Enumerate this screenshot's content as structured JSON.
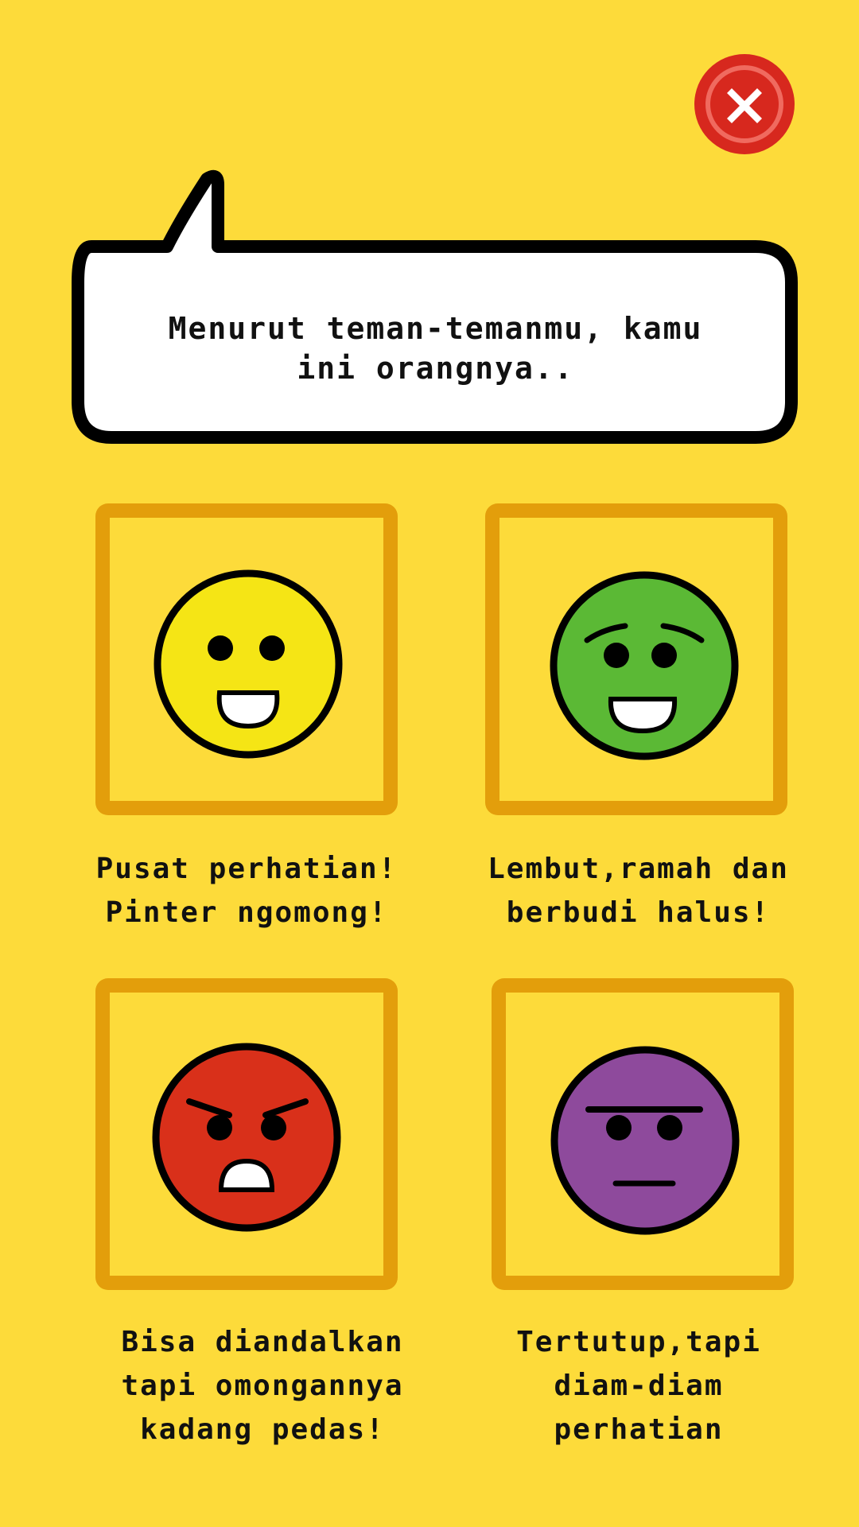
{
  "close_button": {
    "icon": "close-icon",
    "color": "#D7281E"
  },
  "question": {
    "text": "Menurut teman-temanmu, kamu\nini orangnya.."
  },
  "options": [
    {
      "label": "Pusat perhatian!\nPinter ngomong!",
      "icon": "happy-yellow-face-icon",
      "face_color": "#F5E515"
    },
    {
      "label": "Lembut,ramah dan\nberbudi halus!",
      "icon": "gentle-green-face-icon",
      "face_color": "#5BB935"
    },
    {
      "label": "Bisa diandalkan\ntapi omongannya\nkadang pedas!",
      "icon": "angry-red-face-icon",
      "face_color": "#D9301A"
    },
    {
      "label": "Tertutup,tapi\ndiam-diam\nperhatian",
      "icon": "neutral-purple-face-icon",
      "face_color": "#8E4A9C"
    }
  ],
  "colors": {
    "background": "#FDDB3A",
    "frame": "#E39E0B"
  }
}
